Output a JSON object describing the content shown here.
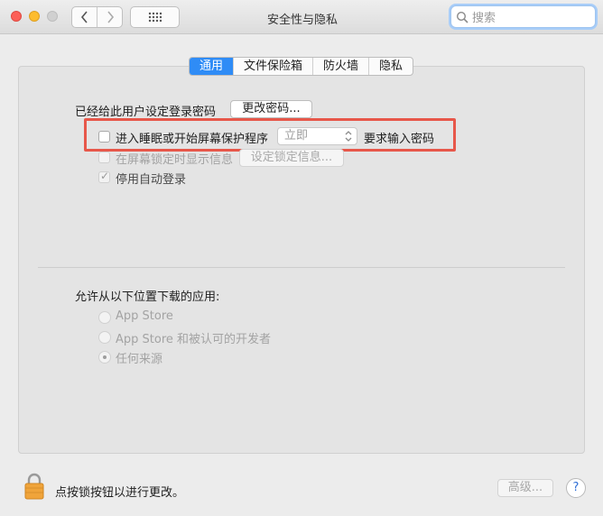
{
  "window": {
    "title": "安全性与隐私"
  },
  "search": {
    "placeholder": "搜索"
  },
  "tabs": [
    {
      "label": "通用",
      "active": true
    },
    {
      "label": "文件保险箱",
      "active": false
    },
    {
      "label": "防火墙",
      "active": false
    },
    {
      "label": "隐私",
      "active": false
    }
  ],
  "general": {
    "password_label": "已经给此用户设定登录密码",
    "change_password_button": "更改密码...",
    "require_password": {
      "label": "进入睡眠或开始屏幕保护程序",
      "checked": false,
      "select_value": "立即",
      "suffix": "要求输入密码"
    },
    "lock_message": {
      "label": "在屏幕锁定时显示信息",
      "checked": false,
      "button": "设定锁定信息..."
    },
    "disable_autologin": {
      "label": "停用自动登录",
      "checked": true
    }
  },
  "downloads": {
    "heading": "允许从以下位置下载的应用:",
    "options": [
      {
        "label": "App Store",
        "selected": false
      },
      {
        "label": "App Store 和被认可的开发者",
        "selected": false
      },
      {
        "label": "任何来源",
        "selected": true
      }
    ]
  },
  "footer": {
    "lock_text": "点按锁按钮以进行更改。",
    "advanced_button": "高级...",
    "help": "?"
  },
  "colors": {
    "accent": "#2f8cf6",
    "highlight_box": "#e7574a"
  },
  "icons": [
    "back-icon",
    "forward-icon",
    "grid-icon",
    "search-icon",
    "chevron-updown-icon",
    "lock-icon",
    "help-icon"
  ]
}
